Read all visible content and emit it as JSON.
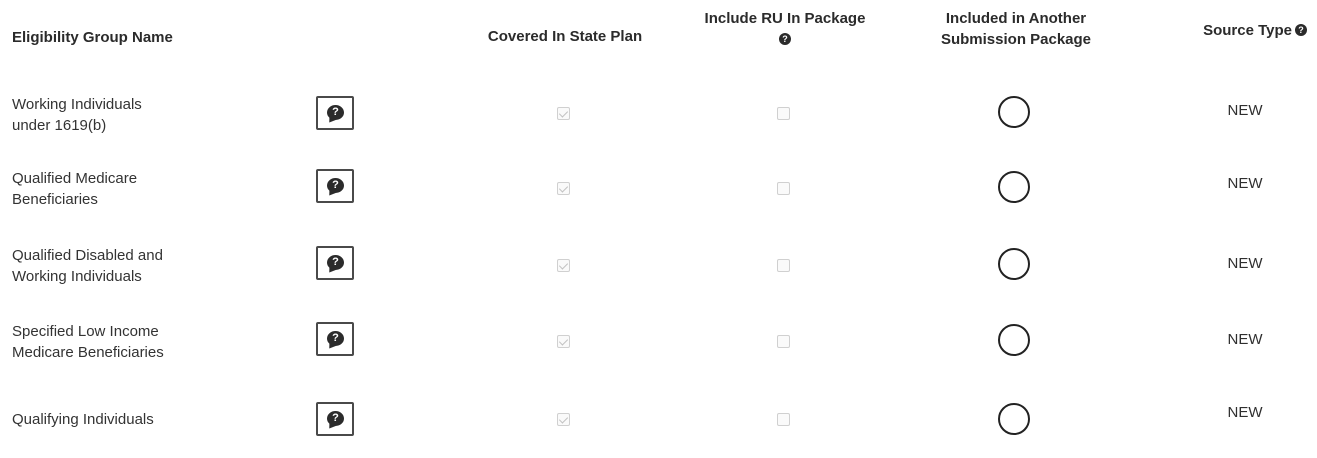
{
  "headers": {
    "name": "Eligibility Group Name",
    "covered": "Covered In State Plan",
    "include_line1": "Include RU In Package",
    "another_line1": "Included in Another",
    "another_line2": "Submission Package",
    "source": "Source Type"
  },
  "icons": {
    "help": "help-question-icon",
    "help_bubble": "question-bubble-icon",
    "checkbox": "checkbox",
    "radio": "radio-button"
  },
  "rows": [
    {
      "line1": "Working Individuals",
      "line2": "under 1619(b)",
      "covered_checked": true,
      "include_checked": false,
      "another_selected": false,
      "source": "NEW"
    },
    {
      "line1": "Qualified Medicare",
      "line2": "Beneficiaries",
      "covered_checked": true,
      "include_checked": false,
      "another_selected": false,
      "source": "NEW"
    },
    {
      "line1": "Qualified Disabled and",
      "line2": "Working Individuals",
      "covered_checked": true,
      "include_checked": false,
      "another_selected": false,
      "source": "NEW"
    },
    {
      "line1": "Specified Low Income",
      "line2": "Medicare Beneficiaries",
      "covered_checked": true,
      "include_checked": false,
      "another_selected": false,
      "source": "NEW"
    },
    {
      "line1": "Qualifying Individuals",
      "line2": "",
      "covered_checked": true,
      "include_checked": false,
      "another_selected": false,
      "source": "NEW"
    }
  ]
}
